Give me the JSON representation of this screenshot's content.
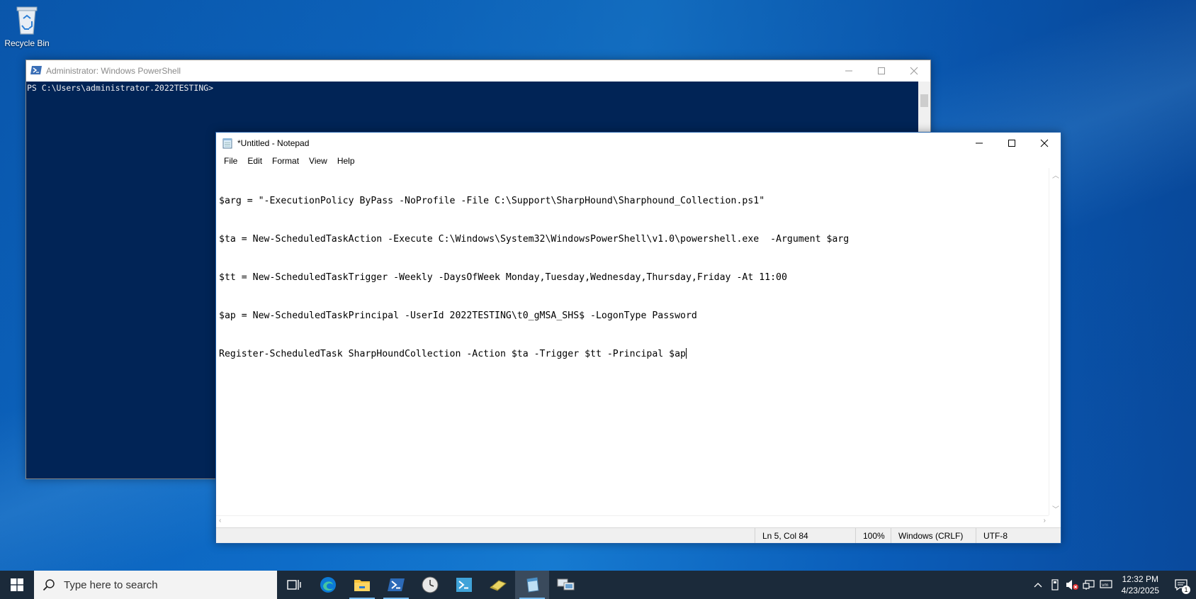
{
  "desktop": {
    "recycle_bin_label": "Recycle Bin"
  },
  "powershell": {
    "title": "Administrator: Windows PowerShell",
    "prompt": "PS C:\\Users\\administrator.2022TESTING>",
    "background": "#012456"
  },
  "notepad": {
    "title": "*Untitled - Notepad",
    "menu": [
      "File",
      "Edit",
      "Format",
      "View",
      "Help"
    ],
    "lines": [
      "$arg = \"-ExecutionPolicy ByPass -NoProfile -File C:\\Support\\SharpHound\\Sharphound_Collection.ps1\"",
      "$ta = New-ScheduledTaskAction -Execute C:\\Windows\\System32\\WindowsPowerShell\\v1.0\\powershell.exe  -Argument $arg",
      "$tt = New-ScheduledTaskTrigger -Weekly -DaysOfWeek Monday,Tuesday,Wednesday,Thursday,Friday -At 11:00",
      "$ap = New-ScheduledTaskPrincipal -UserId 2022TESTING\\t0_gMSA_SHS$ -LogonType Password",
      "Register-ScheduledTask SharpHoundCollection -Action $ta -Trigger $tt -Principal $ap"
    ],
    "status": {
      "position": "Ln 5, Col 84",
      "zoom": "100%",
      "line_ending": "Windows (CRLF)",
      "encoding": "UTF-8"
    }
  },
  "taskbar": {
    "search_placeholder": "Type here to search",
    "apps": [
      "task-view",
      "edge",
      "file-explorer",
      "powershell",
      "clock-app",
      "powershell-ise",
      "eraser-app",
      "notepad",
      "network-app"
    ],
    "clock_time": "12:32 PM",
    "clock_date": "4/23/2025",
    "notification_count": "1",
    "accent": "#76b9ed"
  }
}
